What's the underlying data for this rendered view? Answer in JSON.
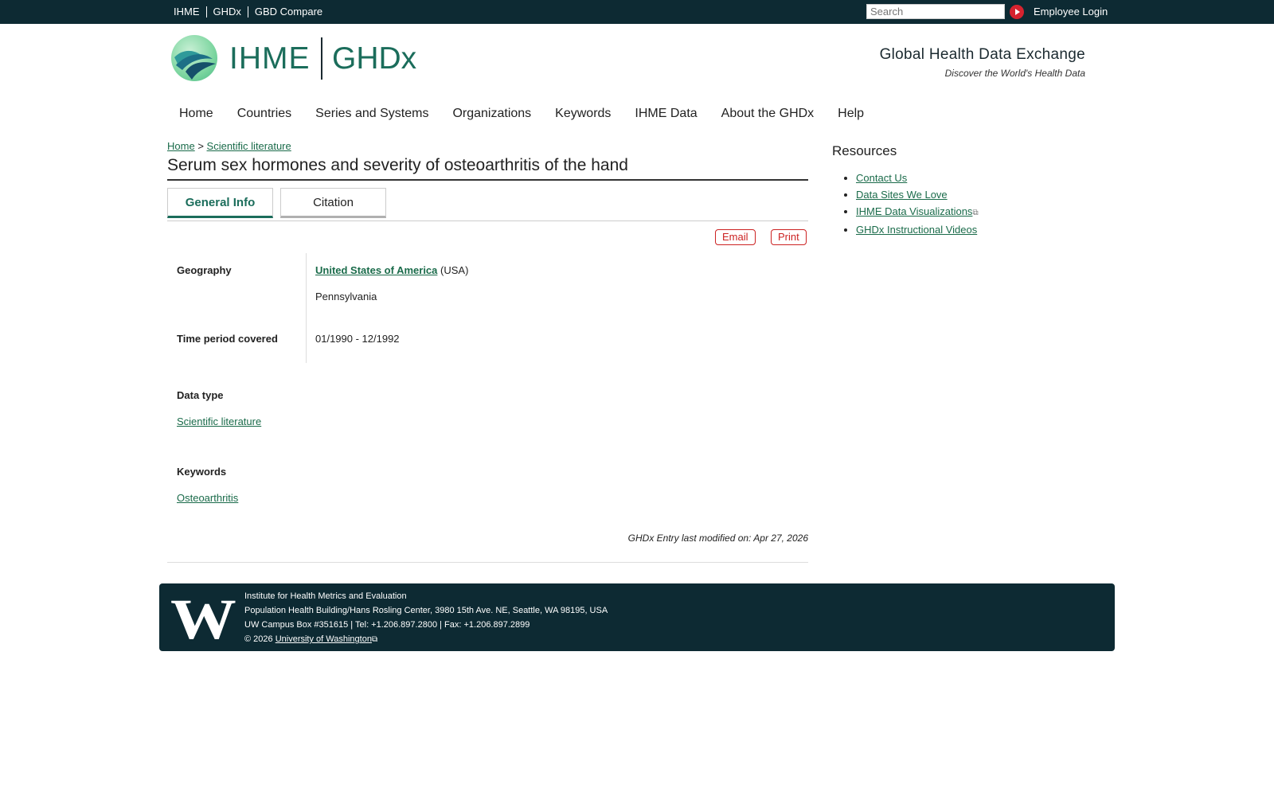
{
  "topbar": {
    "links": [
      "IHME",
      "GHDx",
      "GBD Compare"
    ],
    "search_placeholder": "Search",
    "login": "Employee Login"
  },
  "header": {
    "logo_ihme": "IHME",
    "logo_ghdx": "GHDx",
    "tagline_title": "Global Health Data Exchange",
    "tagline_sub": "Discover the World's Health Data"
  },
  "nav": {
    "items": [
      "Home",
      "Countries",
      "Series and Systems",
      "Organizations",
      "Keywords",
      "IHME Data",
      "About the GHDx",
      "Help"
    ]
  },
  "breadcrumb": {
    "home": "Home",
    "separator": ">",
    "current": "Scientific literature"
  },
  "page": {
    "title": "Serum sex hormones and severity of osteoarthritis of the hand",
    "tabs": [
      "General Info",
      "Citation"
    ],
    "email_label": "Email",
    "print_label": "Print",
    "geography_label": "Geography",
    "country": "United States of America",
    "country_code": "(USA)",
    "region": "Pennsylvania",
    "time_label": "Time period covered",
    "time_value": "01/1990 - 12/1992",
    "datatype_label": "Data type",
    "datatype_value": "Scientific literature",
    "keywords_label": "Keywords",
    "keyword_value": "Osteoarthritis",
    "modified": "GHDx Entry last modified on: Apr 27, 2026"
  },
  "sidebar": {
    "title": "Resources",
    "items": [
      "Contact Us",
      "Data Sites We Love",
      "IHME Data Visualizations",
      "GHDx Instructional Videos"
    ]
  },
  "footer": {
    "logo_letter": "W",
    "line1": "Institute for Health Metrics and Evaluation",
    "line2": "Population Health Building/Hans Rosling Center, 3980 15th Ave. NE, Seattle, WA 98195, USA",
    "line3": "UW Campus Box #351615 | Tel: +1.206.897.2800 | Fax: +1.206.897.2899",
    "copyright": "© 2026",
    "uw_link": "University of Washington"
  },
  "colors": {
    "topbar": "#0d2a33",
    "brand_green": "#1b6d5b",
    "link": "#1a6b4a",
    "action_red": "#cc2222"
  }
}
